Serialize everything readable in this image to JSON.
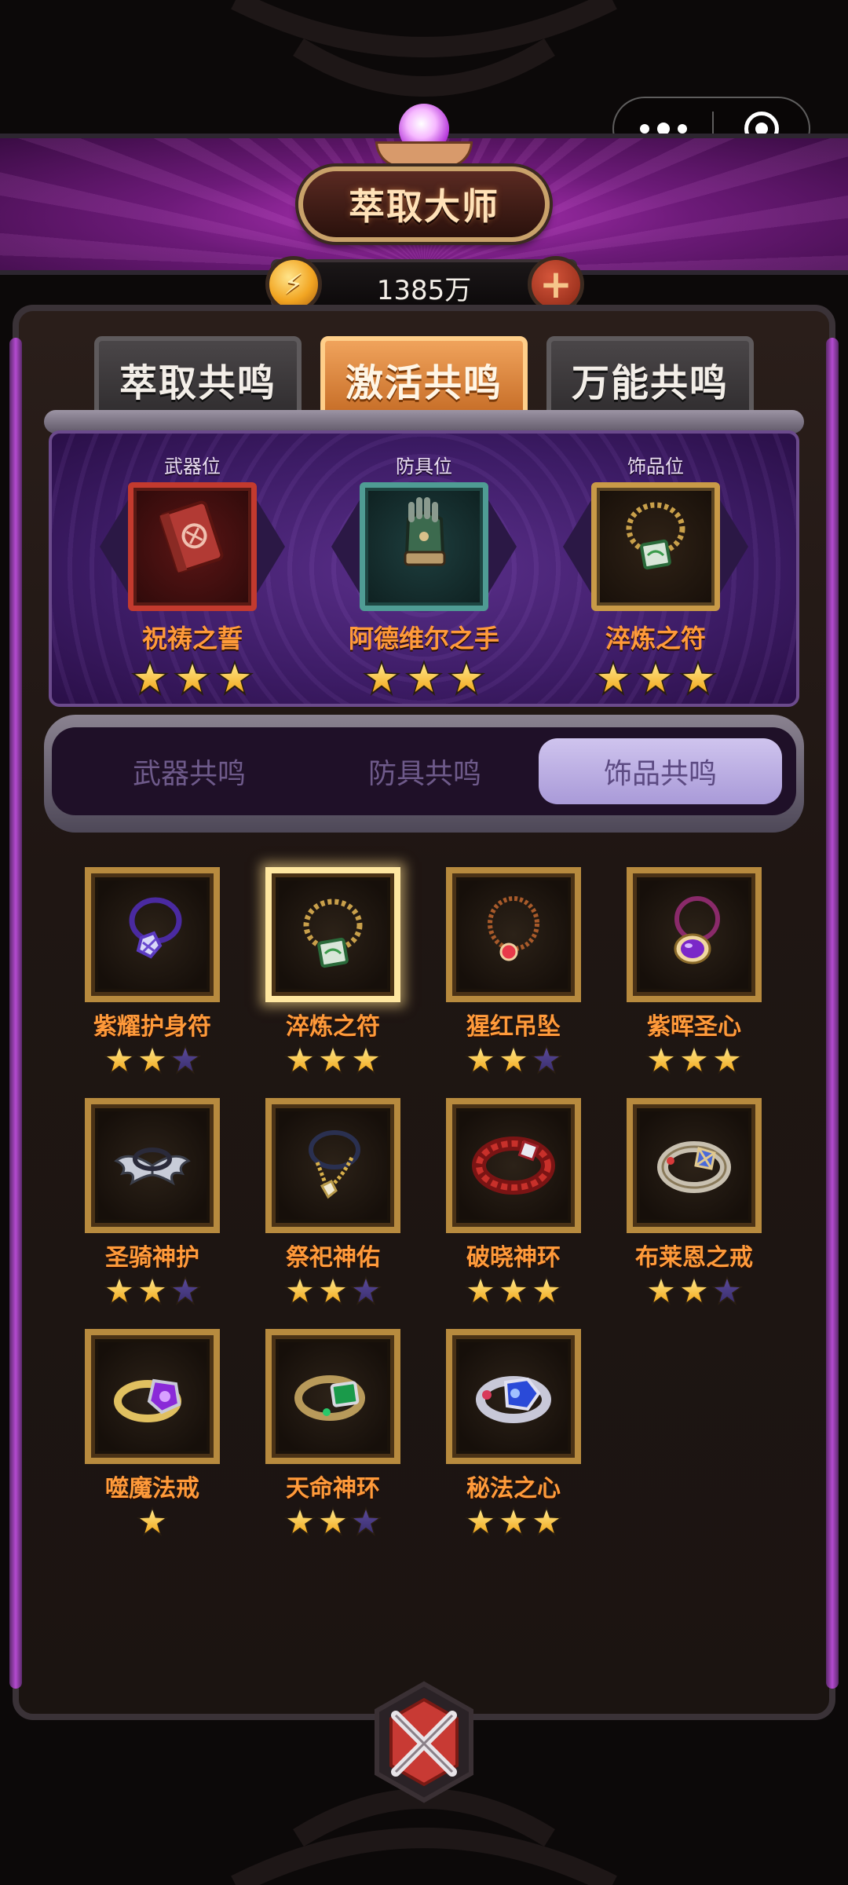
{
  "header": {
    "title": "萃取大师",
    "currency_amount": "1385万",
    "currency_icon": "coin-icon",
    "add_icon": "plus-icon"
  },
  "capsule": {
    "more_icon": "more-dots-icon",
    "close_icon": "target-close-icon"
  },
  "top_tabs": [
    {
      "label": "萃取共鸣",
      "active": false
    },
    {
      "label": "激活共鸣",
      "active": true
    },
    {
      "label": "万能共鸣",
      "active": false
    }
  ],
  "equip_slots": [
    {
      "slot": "武器位",
      "name": "祝祷之誓",
      "stars": 3,
      "frame": "red",
      "icon": "red-book-icon"
    },
    {
      "slot": "防具位",
      "name": "阿德维尔之手",
      "stars": 3,
      "frame": "teal",
      "icon": "gauntlet-icon"
    },
    {
      "slot": "饰品位",
      "name": "淬炼之符",
      "stars": 3,
      "frame": "gold",
      "icon": "bead-necklace-icon"
    }
  ],
  "sub_tabs": [
    {
      "label": "武器共鸣",
      "active": false
    },
    {
      "label": "防具共鸣",
      "active": false
    },
    {
      "label": "饰品共鸣",
      "active": true
    }
  ],
  "items": [
    {
      "name": "紫耀护身符",
      "stars": 2,
      "max": 3,
      "icon": "purple-amulet-icon",
      "selected": false
    },
    {
      "name": "淬炼之符",
      "stars": 3,
      "max": 3,
      "icon": "bead-necklace-icon",
      "selected": true
    },
    {
      "name": "猩红吊坠",
      "stars": 2,
      "max": 3,
      "icon": "red-pendant-icon",
      "selected": false
    },
    {
      "name": "紫晖圣心",
      "stars": 3,
      "max": 3,
      "icon": "purple-heart-pendant-icon",
      "selected": false
    },
    {
      "name": "圣骑神护",
      "stars": 2,
      "max": 3,
      "icon": "winged-collar-icon",
      "selected": false
    },
    {
      "name": "祭祀神佑",
      "stars": 2,
      "max": 3,
      "icon": "gold-chain-icon",
      "selected": false
    },
    {
      "name": "破晓神环",
      "stars": 3,
      "max": 3,
      "icon": "red-bracelet-icon",
      "selected": false
    },
    {
      "name": "布莱恩之戒",
      "stars": 2,
      "max": 3,
      "icon": "silver-ring-icon",
      "selected": false
    },
    {
      "name": "噬魔法戒",
      "stars": 1,
      "max": 1,
      "icon": "amethyst-ring-icon",
      "selected": false
    },
    {
      "name": "天命神环",
      "stars": 2,
      "max": 3,
      "icon": "emerald-ring-icon",
      "selected": false
    },
    {
      "name": "秘法之心",
      "stars": 3,
      "max": 3,
      "icon": "sapphire-ring-icon",
      "selected": false
    }
  ],
  "footer": {
    "emblem_icon": "crossed-swords-emblem-icon"
  },
  "colors": {
    "accent_orange": "#ff9a3a",
    "frame_gold": "#b78a3e",
    "active_tab": "#e89a50",
    "purple": "#3d1c66"
  }
}
